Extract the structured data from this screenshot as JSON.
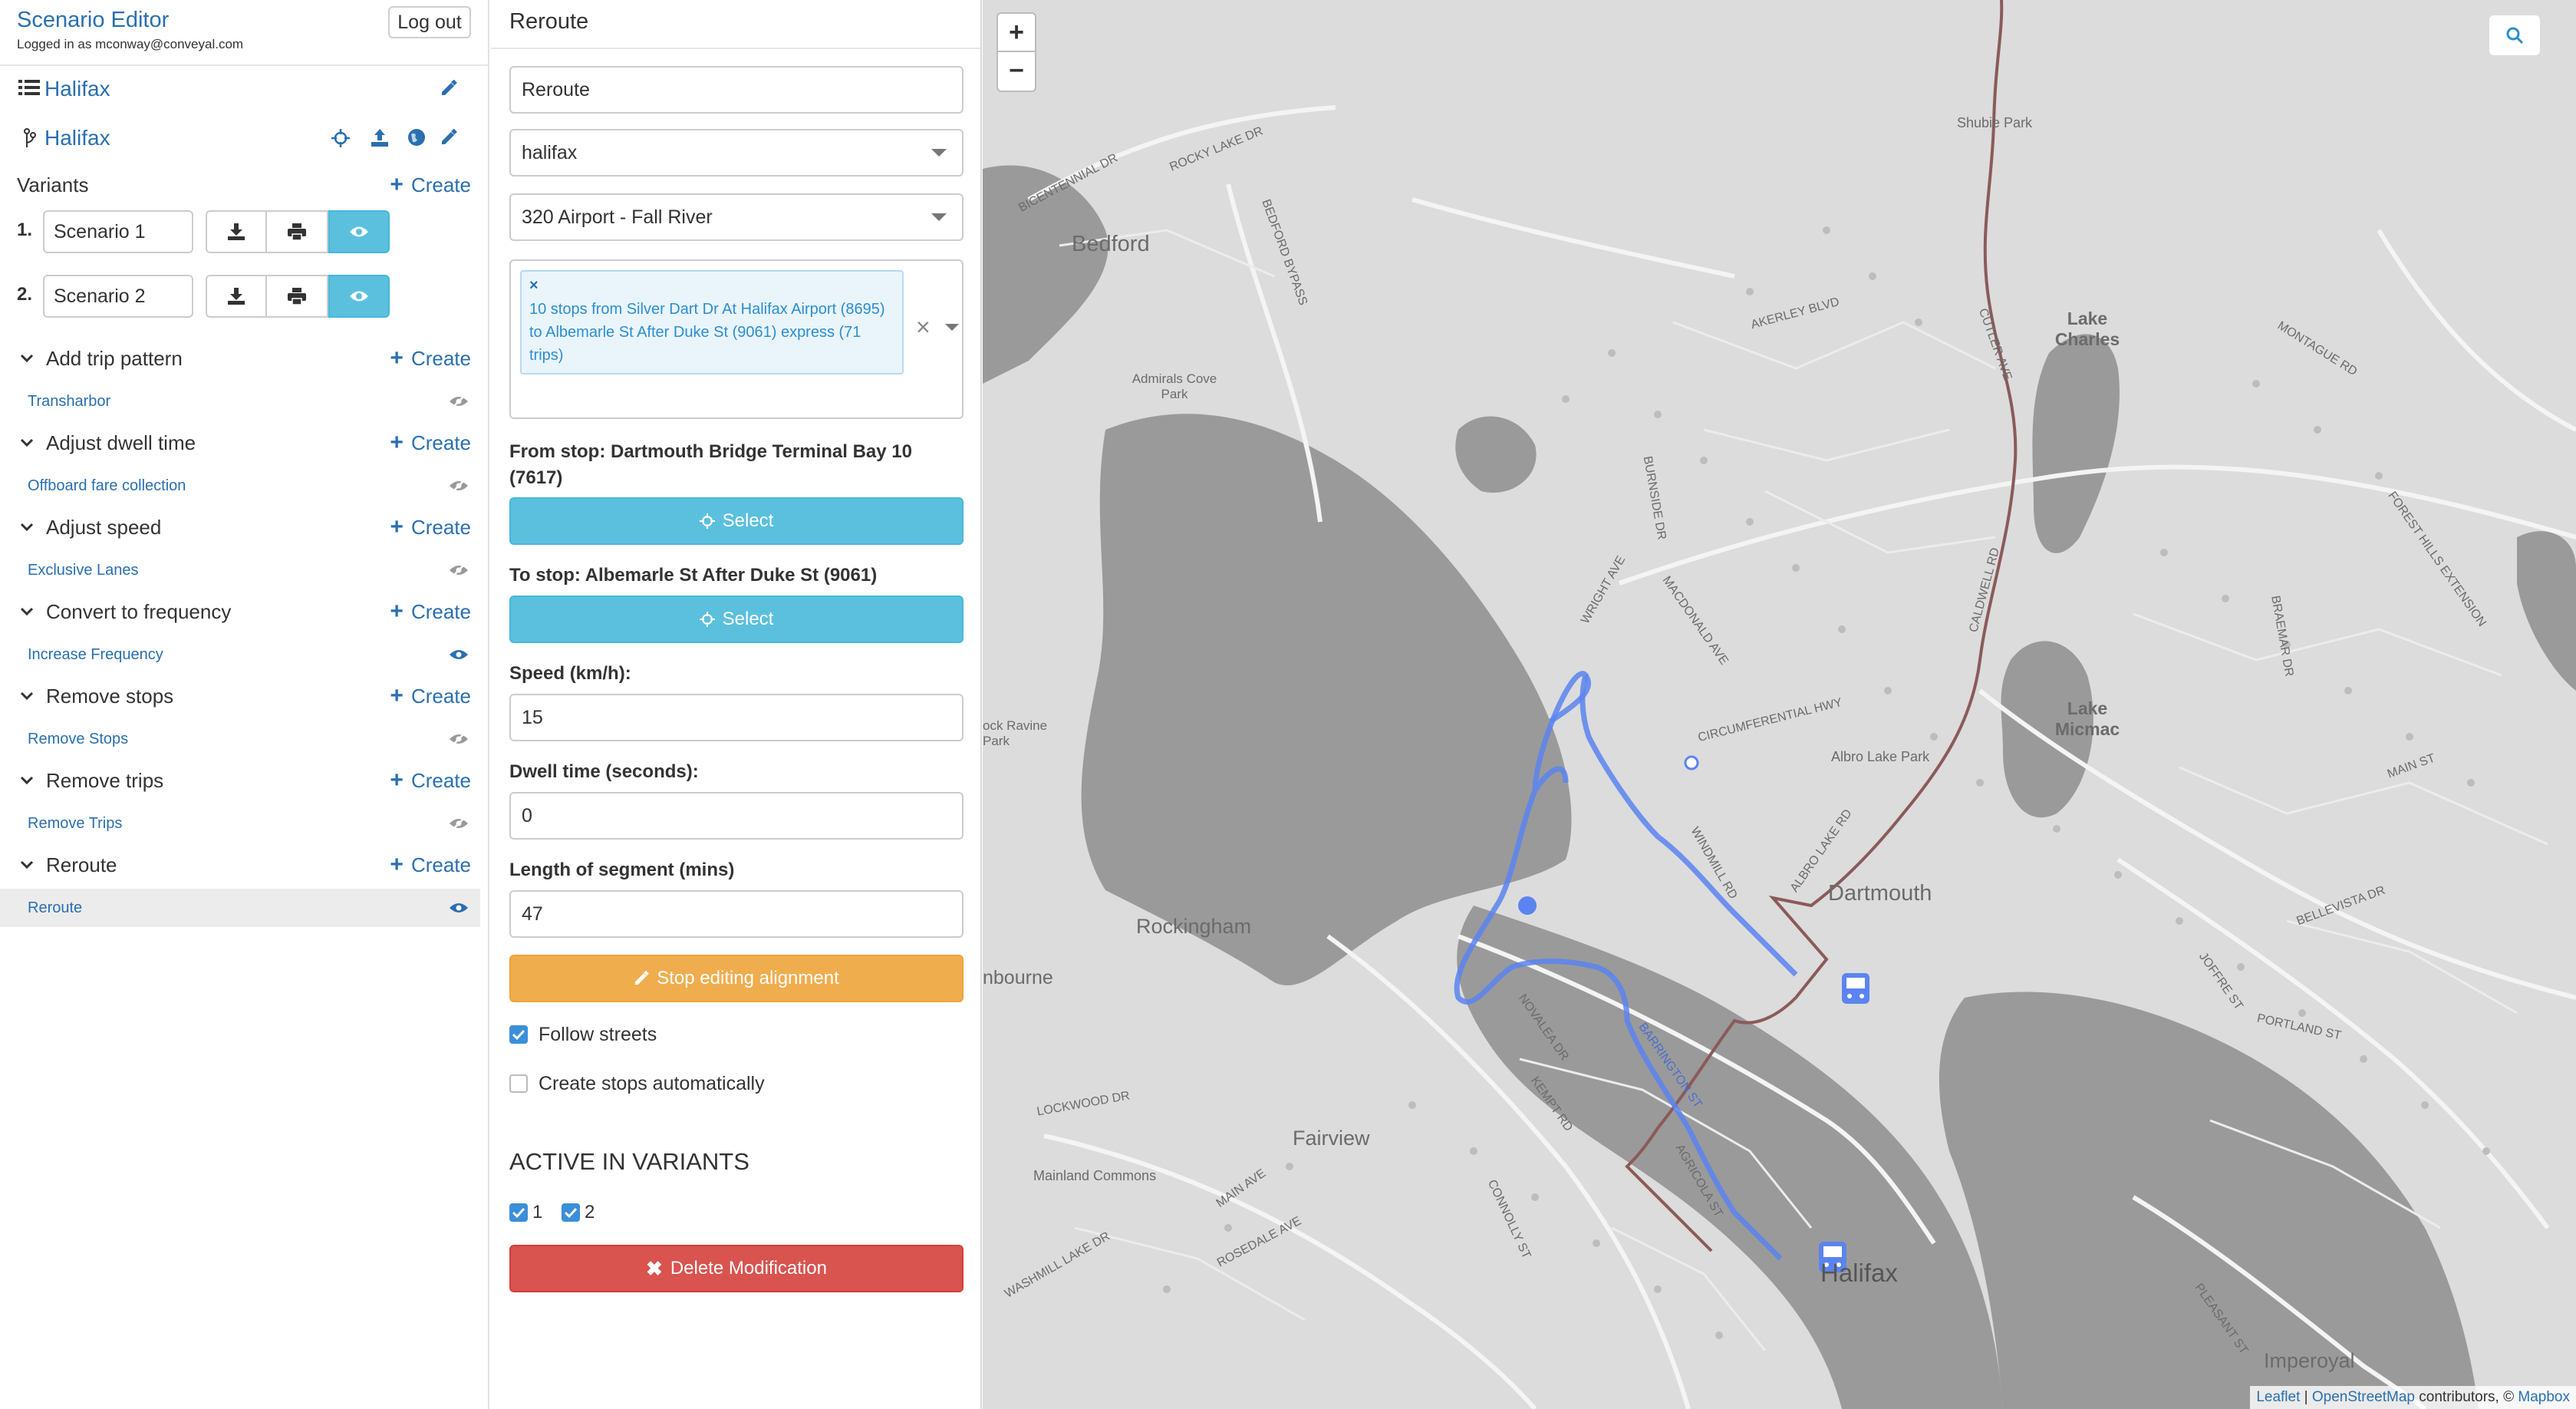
{
  "header": {
    "app_title": "Scenario Editor",
    "logged_in": "Logged in as mconway@conveyal.com",
    "logout_label": "Log out"
  },
  "project": {
    "name": "Halifax"
  },
  "bundle": {
    "name": "Halifax"
  },
  "variants": {
    "title": "Variants",
    "create_label": "Create",
    "items": [
      {
        "number": "1.",
        "name": "Scenario 1"
      },
      {
        "number": "2.",
        "name": "Scenario 2"
      }
    ]
  },
  "modification_groups": [
    {
      "type": "Add trip pattern",
      "create_label": "Create",
      "items": [
        "Transharbor"
      ]
    },
    {
      "type": "Adjust dwell time",
      "create_label": "Create",
      "items": [
        "Offboard fare collection"
      ]
    },
    {
      "type": "Adjust speed",
      "create_label": "Create",
      "items": [
        "Exclusive Lanes"
      ]
    },
    {
      "type": "Convert to frequency",
      "create_label": "Create",
      "items": [
        "Increase Frequency"
      ]
    },
    {
      "type": "Remove stops",
      "create_label": "Create",
      "items": [
        "Remove Stops"
      ]
    },
    {
      "type": "Remove trips",
      "create_label": "Create",
      "items": [
        "Remove Trips"
      ]
    },
    {
      "type": "Reroute",
      "create_label": "Create",
      "items": [
        "Reroute"
      ]
    }
  ],
  "form": {
    "title": "Reroute",
    "name_value": "Reroute",
    "feed_value": "halifax",
    "route_value": "320 Airport - Fall River",
    "pattern_tag": "10 stops from Silver Dart Dr At Halifax Airport (8695) to Albemarle St After Duke St (9061) express (71 trips)",
    "pattern_tag_close": "×",
    "clear_glyph": "×",
    "from_stop_label": "From stop: Dartmouth Bridge Terminal Bay 10 (7617)",
    "select_label": "Select",
    "to_stop_label": "To stop: Albemarle St After Duke St (9061)",
    "speed_label": "Speed (km/h):",
    "speed_value": "15",
    "dwell_label": "Dwell time (seconds):",
    "dwell_value": "0",
    "segment_label": "Length of segment (mins)",
    "segment_value": "47",
    "stop_editing_label": "Stop editing alignment",
    "follow_streets_label": "Follow streets",
    "follow_streets_checked": true,
    "create_stops_label": "Create stops automatically",
    "create_stops_checked": false,
    "active_heading": "ACTIVE IN VARIANTS",
    "active_variants": [
      {
        "label": "1",
        "checked": true
      },
      {
        "label": "2",
        "checked": true
      }
    ],
    "delete_label": "Delete Modification"
  },
  "map": {
    "zoom_in": "+",
    "zoom_out": "−",
    "attribution": {
      "leaflet": "Leaflet",
      "sep": " | ",
      "osm": "OpenStreetMap",
      "contrib": " contributors, © ",
      "mapbox": "Mapbox"
    },
    "places": [
      "Bedford",
      "Lake Charles",
      "Lake Micmac",
      "Dartmouth",
      "Rockingham",
      "Fairview",
      "Halifax",
      "Imperoyal",
      "Shubie Park",
      "Admirals Cove Park",
      "Albro Lake Park",
      "Mainland Commons",
      "ock Ravine Park",
      "nbourne"
    ],
    "streets": [
      "ROCKY LAKE DR",
      "BEDFORD BYPASS",
      "BICENTENNIAL DR",
      "AKERLEY BLVD",
      "CUTLER AVE",
      "MONTAGUE RD",
      "CIRCUMFERENTIAL HWY",
      "BURNSIDE DR",
      "WRIGHT AVE",
      "MACDONALD AVE",
      "WINDMILL RD",
      "ALBRO LAKE RD",
      "MAIN ST",
      "BELLEVISTA DR",
      "PORTLAND ST",
      "JOFFRE ST",
      "KEMPT RD",
      "AGRICOLA ST",
      "NOVALEA DR",
      "BARRINGTON ST",
      "CONNOLLY ST",
      "ROSEDALE AVE",
      "WASHMILL LAKE DR",
      "MAIN AVE",
      "FOREST HILLS EXTENSION",
      "BRAEMAR DR",
      "CALDWELL RD",
      "PLEASANT ST",
      "LOCKWOOD DR"
    ],
    "colors": {
      "water": "#9a9a9a",
      "land": "#dcdcdc",
      "reroute": "#5b84f0",
      "original_route": "#8b5a5a"
    }
  }
}
